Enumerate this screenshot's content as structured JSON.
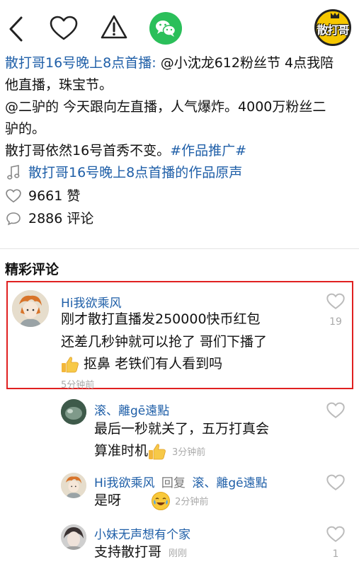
{
  "top_bar": {
    "logo_text": "散打哥",
    "brand_color": "#2bbf5a"
  },
  "post": {
    "line1_blue": "散打哥16号晚上8点首播:",
    "line1_rest": " @小沈龙612粉丝节 4点我陪",
    "line2": "他直播，珠宝节。",
    "line3": "@二驴的 今天跟向左直播，人气爆炸。4000万粉丝二",
    "line4": "驴的。",
    "line5_plain": "散打哥依然16号首秀不变。",
    "line5_tag": "#作品推广#",
    "music": "散打哥16号晚上8点首播的作品原声",
    "likes": "9661 赞",
    "comments": "2886 评论"
  },
  "section_title": "精彩评论",
  "comments": [
    {
      "user": "Hi我欲乘风",
      "text1": "刚才散打直播发250000快币红包",
      "text2": "还差几秒钟就可以抢了  哥们下播了",
      "text3": " 抠鼻      老铁们有人看到吗",
      "time": "5分钟前",
      "likes": "19"
    },
    {
      "user": "滚、離gē遠點",
      "text1": "最后一秒就关了，五万打真会",
      "text2": "算准时机",
      "time": "3分钟前"
    },
    {
      "user": "Hi我欲乘风",
      "reply_word": "回复",
      "reply_to": "滚、離gē遠點",
      "text1": "是呀",
      "time": "2分钟前"
    },
    {
      "user": "小妹无声想有个家",
      "text1": "支持散打哥",
      "time": "刚刚",
      "likes": "1"
    }
  ]
}
